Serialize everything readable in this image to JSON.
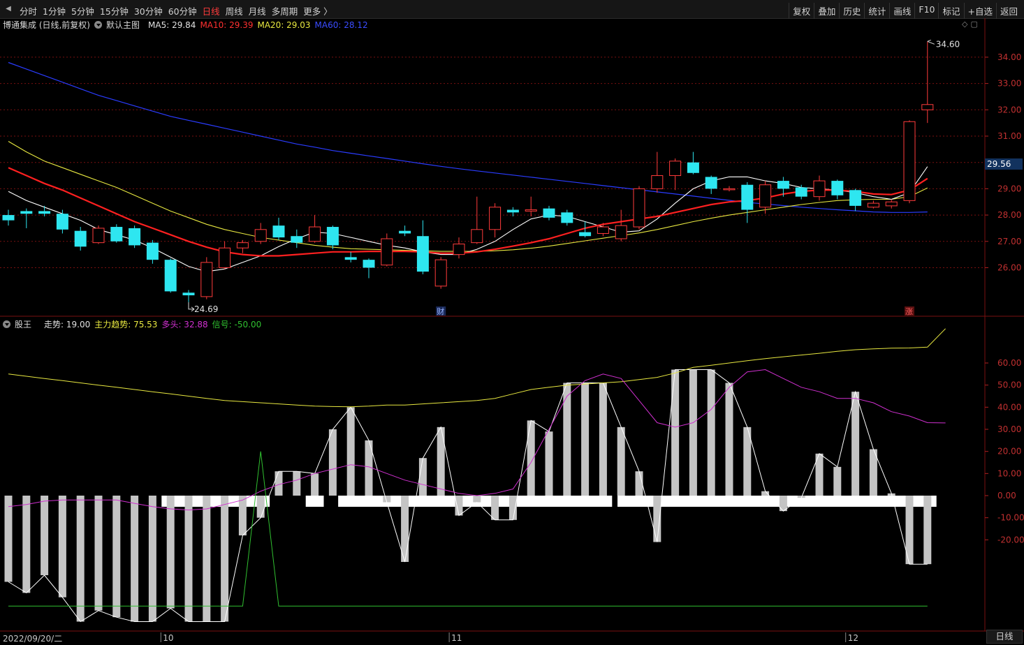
{
  "toolbar": {
    "periods": [
      "分时",
      "1分钟",
      "5分钟",
      "15分钟",
      "30分钟",
      "60分钟",
      "日线",
      "周线",
      "月线",
      "多周期",
      "更多 〉"
    ],
    "active_period": "日线",
    "tools": [
      "复权",
      "叠加",
      "历史",
      "统计",
      "画线",
      "F10",
      "标记",
      "+自选",
      "返回"
    ]
  },
  "main_legend": {
    "title": "博通集成 (日线,前复权)",
    "template": "默认主图",
    "ma5": "MA5: 29.84",
    "ma10": "MA10: 29.39",
    "ma20": "MA20: 29.03",
    "ma60": "MA60: 28.12"
  },
  "sub_legend": {
    "name": "股王",
    "trend": "走势: 19.00",
    "main_trend": "主力趋势: 75.53",
    "bull": "多头: 32.88",
    "signal": "信号: -50.00"
  },
  "colors": {
    "up": "#ff3b3b",
    "down": "#2ee6f0",
    "ma5": "#ffffff",
    "ma10": "#ff2020",
    "ma20": "#e8e840",
    "ma60": "#2a3cff",
    "bull": "#d030d0",
    "signal": "#30c030",
    "main_trend": "#e8e840",
    "grid": "#7a1010"
  },
  "current_price_badge": "29.56",
  "high_label": "34.60",
  "low_label": "24.69",
  "markers": {
    "cai": "财",
    "zhang": "涨"
  },
  "date_label": "2022/09/20/二",
  "period_button": "日线",
  "chart_data": [
    {
      "type": "candlestick",
      "title": "博通集成 (日线,前复权)",
      "y_ticks": [
        "34.00",
        "33.00",
        "32.00",
        "31.00",
        "30.00",
        "29.00",
        "28.00",
        "27.00",
        "26.00"
      ],
      "ylim": [
        24.5,
        34.9
      ],
      "x_month_labels": [
        {
          "index": 9,
          "label": "10"
        },
        {
          "index": 25,
          "label": "11"
        },
        {
          "index": 47,
          "label": "12"
        }
      ],
      "ohlc": [
        [
          28.0,
          28.2,
          27.6,
          27.8
        ],
        [
          28.15,
          28.25,
          27.5,
          28.05
        ],
        [
          28.15,
          28.35,
          27.95,
          28.05
        ],
        [
          28.05,
          28.2,
          27.3,
          27.45
        ],
        [
          27.4,
          27.55,
          26.65,
          26.8
        ],
        [
          26.95,
          27.6,
          26.9,
          27.5
        ],
        [
          27.55,
          27.65,
          26.95,
          27.0
        ],
        [
          27.5,
          27.6,
          26.75,
          26.85
        ],
        [
          26.95,
          27.05,
          26.15,
          26.3
        ],
        [
          26.3,
          26.35,
          25.05,
          25.1
        ],
        [
          25.05,
          25.15,
          24.69,
          24.95
        ],
        [
          24.9,
          26.4,
          24.8,
          26.2
        ],
        [
          26.0,
          27.0,
          25.95,
          26.75
        ],
        [
          26.75,
          27.05,
          26.55,
          26.95
        ],
        [
          27.0,
          27.7,
          26.9,
          27.45
        ],
        [
          27.6,
          27.9,
          27.05,
          27.15
        ],
        [
          27.2,
          27.45,
          26.75,
          26.95
        ],
        [
          27.0,
          28.0,
          26.95,
          27.55
        ],
        [
          27.55,
          27.6,
          26.7,
          26.85
        ],
        [
          26.4,
          26.6,
          26.2,
          26.3
        ],
        [
          26.3,
          26.35,
          25.6,
          26.0
        ],
        [
          26.1,
          27.3,
          26.05,
          27.1
        ],
        [
          27.4,
          27.6,
          27.2,
          27.3
        ],
        [
          27.2,
          27.8,
          25.75,
          25.85
        ],
        [
          25.3,
          26.4,
          25.2,
          26.3
        ],
        [
          26.5,
          27.15,
          26.35,
          26.9
        ],
        [
          26.95,
          28.7,
          26.9,
          27.45
        ],
        [
          27.45,
          28.45,
          27.15,
          28.3
        ],
        [
          28.2,
          28.3,
          27.95,
          28.1
        ],
        [
          28.15,
          28.7,
          27.95,
          28.2
        ],
        [
          28.25,
          28.35,
          27.8,
          27.9
        ],
        [
          28.1,
          28.2,
          27.6,
          27.7
        ],
        [
          27.35,
          27.75,
          27.15,
          27.2
        ],
        [
          27.3,
          27.7,
          27.2,
          27.55
        ],
        [
          27.1,
          28.2,
          27.0,
          27.6
        ],
        [
          27.55,
          29.1,
          27.45,
          29.0
        ],
        [
          29.0,
          30.4,
          28.85,
          29.5
        ],
        [
          29.5,
          30.15,
          28.95,
          30.05
        ],
        [
          30.0,
          30.4,
          29.55,
          29.6
        ],
        [
          29.45,
          29.5,
          28.8,
          29.0
        ],
        [
          29.0,
          29.1,
          28.9,
          29.0
        ],
        [
          29.15,
          29.25,
          27.7,
          28.2
        ],
        [
          28.3,
          29.3,
          28.05,
          29.15
        ],
        [
          29.3,
          29.45,
          28.7,
          29.0
        ],
        [
          29.05,
          29.15,
          28.6,
          28.7
        ],
        [
          28.7,
          29.5,
          28.55,
          29.3
        ],
        [
          29.3,
          29.35,
          28.6,
          28.75
        ],
        [
          28.95,
          29.0,
          28.15,
          28.35
        ],
        [
          28.3,
          28.55,
          28.25,
          28.45
        ],
        [
          28.35,
          28.6,
          28.25,
          28.5
        ],
        [
          28.55,
          31.6,
          28.45,
          31.55
        ],
        [
          32.0,
          34.6,
          31.5,
          32.2
        ]
      ],
      "series": [
        {
          "name": "MA5",
          "values": [
            28.9,
            28.55,
            28.3,
            28.05,
            27.8,
            27.45,
            27.25,
            27.05,
            26.75,
            26.4,
            26.05,
            25.85,
            25.95,
            26.2,
            26.45,
            26.8,
            27.1,
            27.35,
            27.3,
            27.15,
            27.0,
            26.85,
            26.75,
            26.6,
            26.5,
            26.5,
            26.7,
            27.0,
            27.45,
            27.85,
            28.0,
            27.95,
            27.75,
            27.55,
            27.35,
            27.4,
            27.85,
            28.45,
            29.0,
            29.3,
            29.45,
            29.45,
            29.3,
            29.2,
            29.05,
            29.0,
            28.95,
            28.85,
            28.7,
            28.6,
            28.85,
            29.84
          ]
        },
        {
          "name": "MA10",
          "values": [
            29.8,
            29.5,
            29.2,
            28.95,
            28.65,
            28.35,
            28.05,
            27.75,
            27.5,
            27.25,
            27.0,
            26.78,
            26.6,
            26.5,
            26.45,
            26.45,
            26.5,
            26.55,
            26.6,
            26.6,
            26.62,
            26.62,
            26.62,
            26.6,
            26.55,
            26.55,
            26.6,
            26.7,
            26.82,
            26.95,
            27.1,
            27.3,
            27.5,
            27.65,
            27.75,
            27.85,
            27.95,
            28.1,
            28.25,
            28.4,
            28.5,
            28.55,
            28.65,
            28.8,
            28.9,
            28.95,
            28.95,
            28.9,
            28.8,
            28.78,
            28.95,
            29.39
          ]
        },
        {
          "name": "MA20",
          "values": [
            30.8,
            30.4,
            30.05,
            29.8,
            29.55,
            29.3,
            29.05,
            28.75,
            28.45,
            28.15,
            27.9,
            27.65,
            27.45,
            27.3,
            27.15,
            27.05,
            26.95,
            26.85,
            26.78,
            26.72,
            26.7,
            26.68,
            26.66,
            26.64,
            26.62,
            26.62,
            26.62,
            26.64,
            26.68,
            26.74,
            26.82,
            26.92,
            27.02,
            27.12,
            27.22,
            27.32,
            27.45,
            27.6,
            27.75,
            27.88,
            28.0,
            28.1,
            28.2,
            28.3,
            28.4,
            28.48,
            28.55,
            28.58,
            28.6,
            28.6,
            28.7,
            29.03
          ]
        },
        {
          "name": "MA60",
          "values": [
            33.8,
            33.55,
            33.3,
            33.05,
            32.8,
            32.55,
            32.35,
            32.15,
            31.95,
            31.75,
            31.6,
            31.45,
            31.3,
            31.15,
            31.0,
            30.85,
            30.7,
            30.58,
            30.45,
            30.35,
            30.25,
            30.15,
            30.05,
            29.95,
            29.85,
            29.76,
            29.68,
            29.6,
            29.52,
            29.44,
            29.36,
            29.28,
            29.2,
            29.12,
            29.04,
            28.96,
            28.88,
            28.8,
            28.72,
            28.64,
            28.56,
            28.48,
            28.42,
            28.36,
            28.3,
            28.25,
            28.2,
            28.16,
            28.12,
            28.1,
            28.1,
            28.12
          ]
        }
      ]
    },
    {
      "type": "bar",
      "title": "股王",
      "y_ticks": [
        "60.00",
        "50.00",
        "40.00",
        "30.00",
        "20.00",
        "10.00",
        "0.00",
        "-10.00",
        "-20.00"
      ],
      "ylim": [
        -60,
        78
      ],
      "trend_bars": [
        -39,
        -44,
        -36,
        -46,
        -57,
        -52,
        -55,
        -57,
        -57,
        -51,
        -57,
        -57,
        -57,
        -18,
        -10,
        11,
        11,
        10,
        30,
        40,
        25,
        -3,
        -30,
        17,
        31,
        -9,
        -3,
        -11,
        -11,
        34,
        29,
        51,
        51,
        51,
        31,
        11,
        -21,
        57,
        57,
        57,
        51,
        31,
        2,
        -7,
        -1,
        19,
        13,
        47,
        21,
        1,
        -31,
        -31,
        19,
        19
      ],
      "main_trend": [
        55,
        54,
        53,
        52,
        51,
        50,
        49,
        48,
        47,
        46,
        45,
        44,
        43,
        42.5,
        42,
        41.5,
        41,
        40.5,
        40.3,
        40.2,
        40.5,
        41,
        41,
        41.5,
        42,
        42.5,
        43,
        44,
        46,
        48,
        49,
        50,
        50.5,
        51,
        51.5,
        52.5,
        53.5,
        55.5,
        58,
        59,
        60,
        61,
        62,
        62.8,
        63.6,
        64.4,
        65.3,
        66,
        66.4,
        66.7,
        66.8,
        67.2,
        75.53
      ],
      "bull": [
        -5,
        -4,
        -2.5,
        -2,
        -2,
        -2,
        -2,
        -3.5,
        -5,
        -6,
        -6.5,
        -6,
        -4,
        -2,
        2,
        5,
        7,
        10,
        12,
        14,
        13,
        10,
        7,
        5,
        3,
        1,
        0,
        1,
        3,
        15,
        30,
        45,
        52,
        55,
        53,
        43,
        33,
        31,
        33,
        39,
        49,
        56,
        57,
        53,
        49,
        47,
        44,
        44,
        42,
        38,
        36,
        33,
        32.88
      ],
      "signal": [
        -50,
        -50,
        -50,
        -50,
        -50,
        -50,
        -50,
        -50,
        -50,
        -50,
        -50,
        -50,
        -50,
        -50,
        20,
        -50,
        -50,
        -50,
        -50,
        -50,
        -50,
        -50,
        -50,
        -50,
        -50,
        -50,
        -50,
        -50,
        -50,
        -50,
        -50,
        -50,
        -50,
        -50,
        -50,
        -50,
        -50,
        -50,
        -50,
        -50,
        -50,
        -50,
        -50,
        -50,
        -50,
        -50,
        -50,
        -50,
        -50,
        -50,
        -50,
        -50
      ],
      "flat_segments": [
        [
          8.5,
          14.5
        ],
        [
          16.5,
          17.5
        ],
        [
          18.3,
          33.5
        ],
        [
          33.8,
          51.5
        ]
      ]
    }
  ]
}
